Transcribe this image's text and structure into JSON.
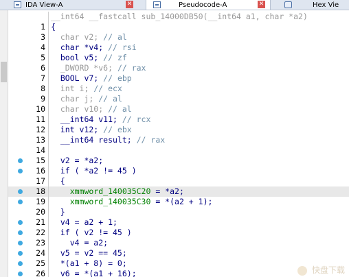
{
  "tabs": [
    {
      "label": "IDA View-A",
      "icon": "ida-view-icon",
      "active": false
    },
    {
      "label": "Pseudocode-A",
      "icon": "pseudocode-icon",
      "active": true
    },
    {
      "label": "Hex Vie",
      "icon": "hex-view-icon",
      "active": false
    }
  ],
  "close_glyph": "✕",
  "watermark": "快盘下载",
  "lines": [
    {
      "num": "",
      "parts": [
        {
          "t": "__int64 __fastcall sub_14000DB50(__int64 a1, char *a2)",
          "c": "tn"
        }
      ]
    },
    {
      "num": "1",
      "parts": [
        {
          "t": "{",
          "c": ""
        }
      ]
    },
    {
      "num": "3",
      "parts": [
        {
          "t": "  char v2; ",
          "c": "tn"
        },
        {
          "t": "// al",
          "c": "cm"
        }
      ]
    },
    {
      "num": "4",
      "parts": [
        {
          "t": "  char *v4; ",
          "c": ""
        },
        {
          "t": "// rsi",
          "c": "cm"
        }
      ]
    },
    {
      "num": "5",
      "parts": [
        {
          "t": "  bool v5; ",
          "c": ""
        },
        {
          "t": "// zf",
          "c": "cm"
        }
      ]
    },
    {
      "num": "6",
      "parts": [
        {
          "t": "  _DWORD *v6; ",
          "c": "tn"
        },
        {
          "t": "// rax",
          "c": "cm"
        }
      ]
    },
    {
      "num": "7",
      "parts": [
        {
          "t": "  BOOL v7; ",
          "c": ""
        },
        {
          "t": "// ebp",
          "c": "cm"
        }
      ]
    },
    {
      "num": "8",
      "parts": [
        {
          "t": "  int i; ",
          "c": "tn"
        },
        {
          "t": "// ecx",
          "c": "cm"
        }
      ]
    },
    {
      "num": "9",
      "parts": [
        {
          "t": "  char j; ",
          "c": "tn"
        },
        {
          "t": "// al",
          "c": "cm"
        }
      ]
    },
    {
      "num": "10",
      "parts": [
        {
          "t": "  char v10; ",
          "c": "tn"
        },
        {
          "t": "// al",
          "c": "cm"
        }
      ]
    },
    {
      "num": "11",
      "parts": [
        {
          "t": "  __int64 v11; ",
          "c": ""
        },
        {
          "t": "// rcx",
          "c": "cm"
        }
      ]
    },
    {
      "num": "12",
      "parts": [
        {
          "t": "  int v12; ",
          "c": ""
        },
        {
          "t": "// ebx",
          "c": "cm"
        }
      ]
    },
    {
      "num": "13",
      "parts": [
        {
          "t": "  __int64 result; ",
          "c": ""
        },
        {
          "t": "// rax",
          "c": "cm"
        }
      ]
    },
    {
      "num": "14",
      "parts": [
        {
          "t": "",
          "c": ""
        }
      ]
    },
    {
      "num": "15",
      "bp": true,
      "parts": [
        {
          "t": "  v2 = *a2;",
          "c": ""
        }
      ]
    },
    {
      "num": "16",
      "bp": true,
      "parts": [
        {
          "t": "  if ( *a2 != 45 )",
          "c": ""
        }
      ]
    },
    {
      "num": "17",
      "parts": [
        {
          "t": "  {",
          "c": ""
        }
      ]
    },
    {
      "num": "18",
      "bp": true,
      "hl": true,
      "parts": [
        {
          "t": "    xmmword_140035C20",
          "c": "gl"
        },
        {
          "t": " = *a2;",
          "c": ""
        }
      ]
    },
    {
      "num": "19",
      "bp": true,
      "parts": [
        {
          "t": "    xmmword_140035C30",
          "c": "gl"
        },
        {
          "t": " = *(a2 + 1);",
          "c": ""
        }
      ]
    },
    {
      "num": "20",
      "parts": [
        {
          "t": "  }",
          "c": ""
        }
      ]
    },
    {
      "num": "21",
      "bp": true,
      "parts": [
        {
          "t": "  v4 = a2 + 1;",
          "c": ""
        }
      ]
    },
    {
      "num": "22",
      "bp": true,
      "parts": [
        {
          "t": "  if ( v2 != 45 )",
          "c": ""
        }
      ]
    },
    {
      "num": "23",
      "bp": true,
      "parts": [
        {
          "t": "    v4 = a2;",
          "c": ""
        }
      ]
    },
    {
      "num": "24",
      "bp": true,
      "parts": [
        {
          "t": "  v5 = v2 == 45;",
          "c": ""
        }
      ]
    },
    {
      "num": "25",
      "bp": true,
      "parts": [
        {
          "t": "  *(a1 + 8) = 0;",
          "c": ""
        }
      ]
    },
    {
      "num": "26",
      "bp": true,
      "parts": [
        {
          "t": "  v6 = *(a1 + 16);",
          "c": ""
        }
      ]
    }
  ]
}
